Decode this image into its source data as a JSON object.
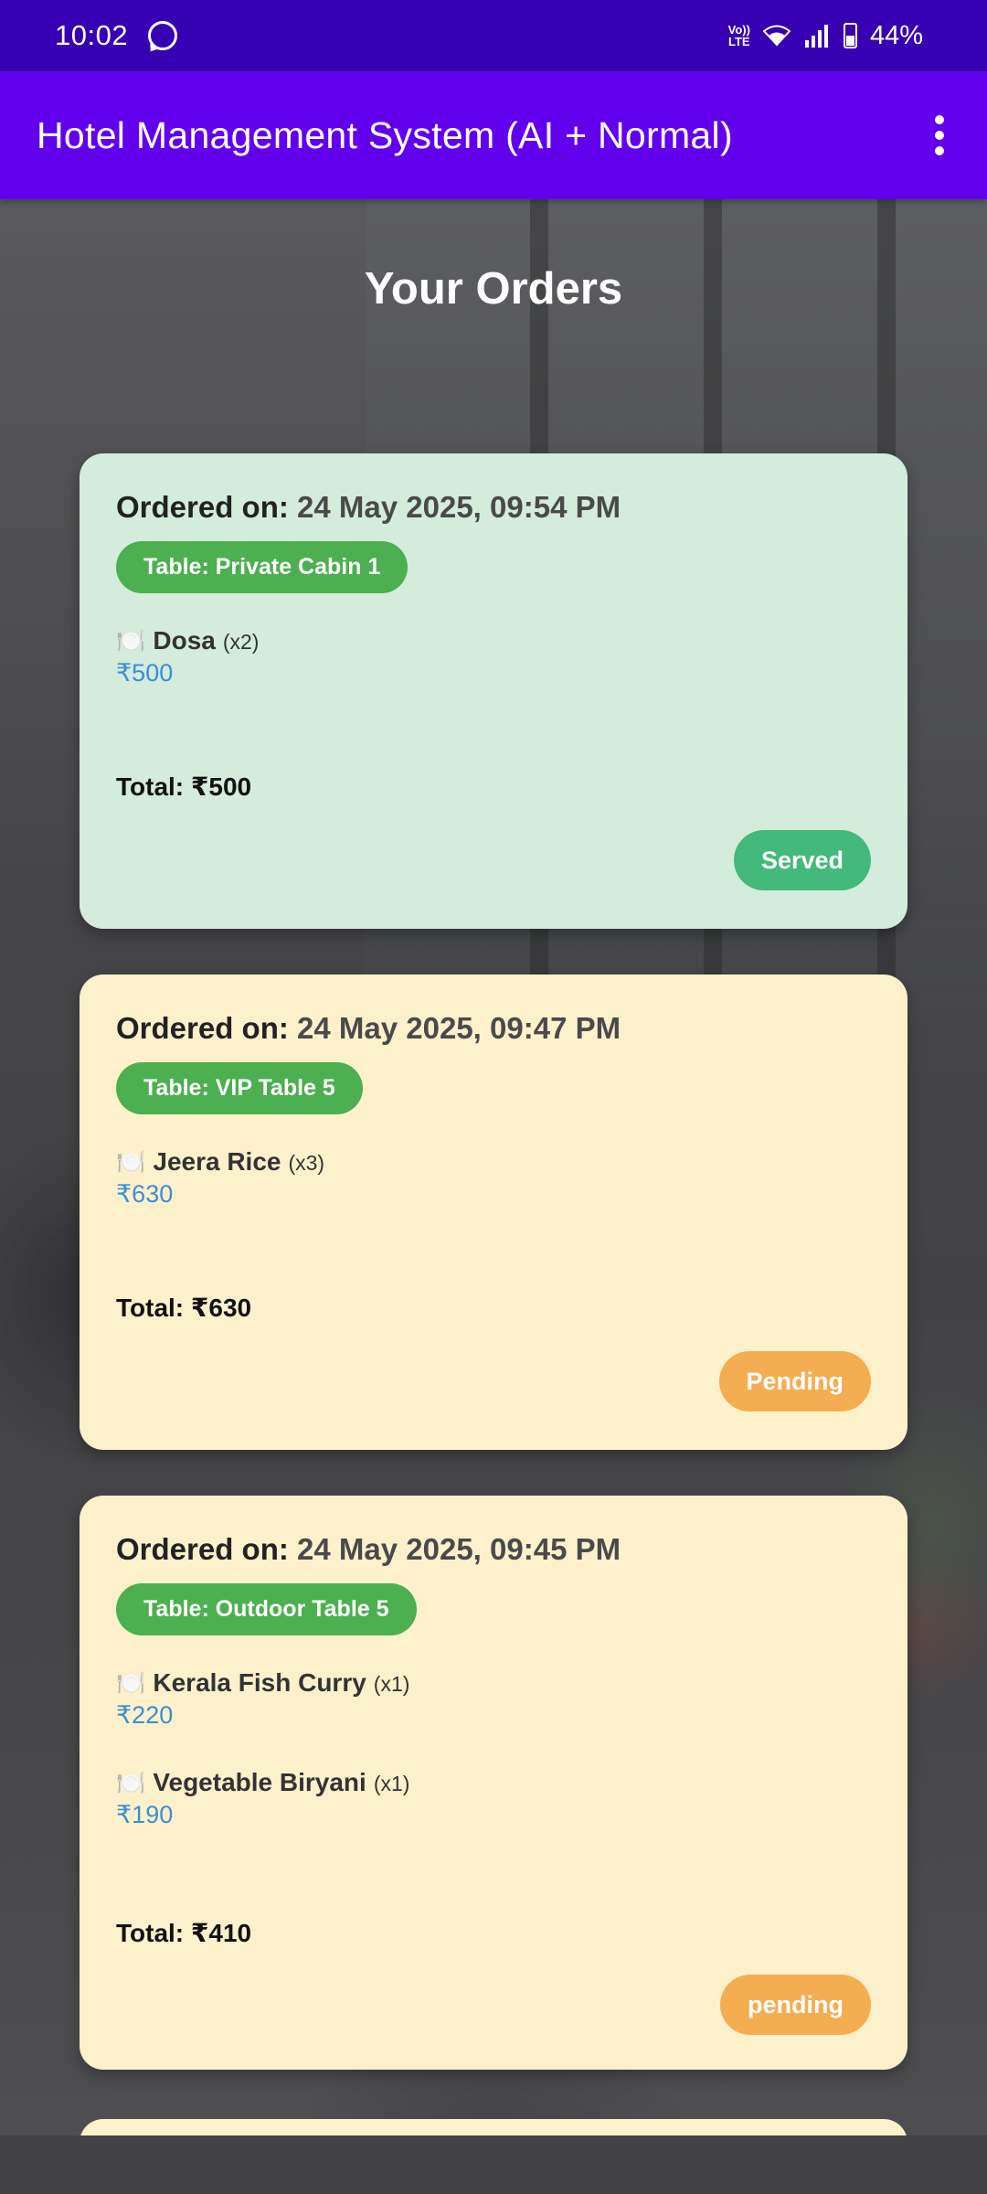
{
  "status_bar": {
    "time": "10:02",
    "network_label_top": "Vo))",
    "network_label_bottom": "LTE",
    "battery_percent": "44%",
    "battery_level": 0.44
  },
  "app_bar": {
    "title": "Hotel Management System (AI + Normal)"
  },
  "page": {
    "heading": "Your Orders"
  },
  "orders": [
    {
      "ordered_label": "Ordered on:",
      "ordered_on": "24 May 2025, 09:54 PM",
      "table": "Table: Private Cabin 1",
      "items": [
        {
          "icon": "🍽️",
          "name": "Dosa",
          "qty": "(x2)",
          "price": "₹500"
        }
      ],
      "total": "Total: ₹500",
      "status": "Served",
      "status_color": "#43b97a",
      "card_color": "#d4ecdc"
    },
    {
      "ordered_label": "Ordered on:",
      "ordered_on": "24 May 2025, 09:47 PM",
      "table": "Table: VIP Table 5",
      "items": [
        {
          "icon": "🍽️",
          "name": "Jeera Rice",
          "qty": "(x3)",
          "price": "₹630"
        }
      ],
      "total": "Total: ₹630",
      "status": "Pending",
      "status_color": "#f5ad52",
      "card_color": "#fdf1cc"
    },
    {
      "ordered_label": "Ordered on:",
      "ordered_on": "24 May 2025, 09:45 PM",
      "table": "Table: Outdoor Table 5",
      "items": [
        {
          "icon": "🍽️",
          "name": "Kerala Fish Curry",
          "qty": "(x1)",
          "price": "₹220"
        },
        {
          "icon": "🍽️",
          "name": "Vegetable Biryani",
          "qty": "(x1)",
          "price": "₹190"
        }
      ],
      "total": "Total: ₹410",
      "status": "pending",
      "status_color": "#f5ad52",
      "card_color": "#fdf1cc"
    }
  ],
  "colors": {
    "status_bar": "#3700b3",
    "app_bar": "#6200ee",
    "table_chip": "#4caf50",
    "price_text": "#3a8fd6"
  }
}
